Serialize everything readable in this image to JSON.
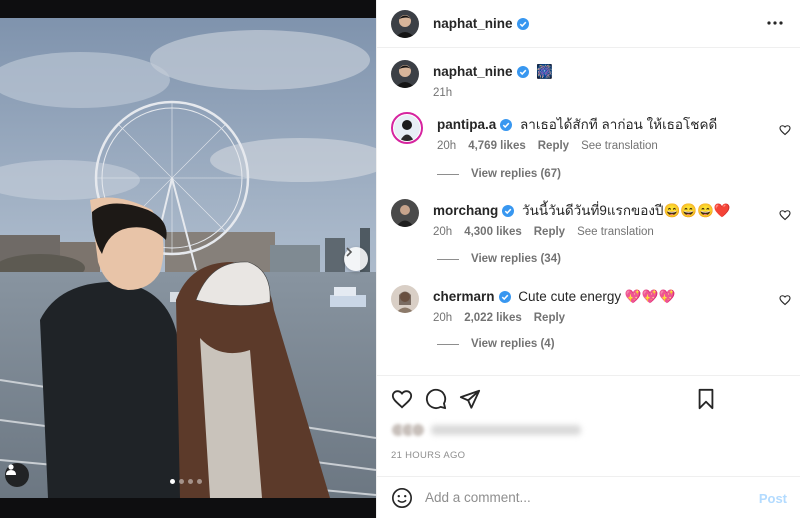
{
  "post": {
    "author": "naphat_nine",
    "caption_emoji": "🎆",
    "caption_time": "21h",
    "photo_count": 4,
    "active_photo": 1
  },
  "comments": [
    {
      "user": "pantipa.a",
      "text": "ลาเธอได้สักที ลาก่อน ให้เธอโชคดี",
      "time": "20h",
      "likes": "4,769 likes",
      "reply": "Reply",
      "translate": "See translation",
      "replies": "View replies (67)"
    },
    {
      "user": "morchang",
      "text": "วันนี้วันดีวันที่9แรกของปี😄😄😄❤️",
      "time": "20h",
      "likes": "4,300 likes",
      "reply": "Reply",
      "translate": "See translation",
      "replies": "View replies (34)"
    },
    {
      "user": "chermarn",
      "text": "Cute cute energy 💖💖💖",
      "time": "20h",
      "likes": "2,022 likes",
      "reply": "Reply",
      "replies": "View replies (4)"
    }
  ],
  "liked_by_blurred": "Liked by others",
  "time_ago": "21 HOURS AGO",
  "composer": {
    "placeholder": "Add a comment...",
    "post_label": "Post"
  },
  "colors": {
    "verified": "#3897f0",
    "muted": "#737373",
    "post_disabled": "#b3dbff"
  }
}
